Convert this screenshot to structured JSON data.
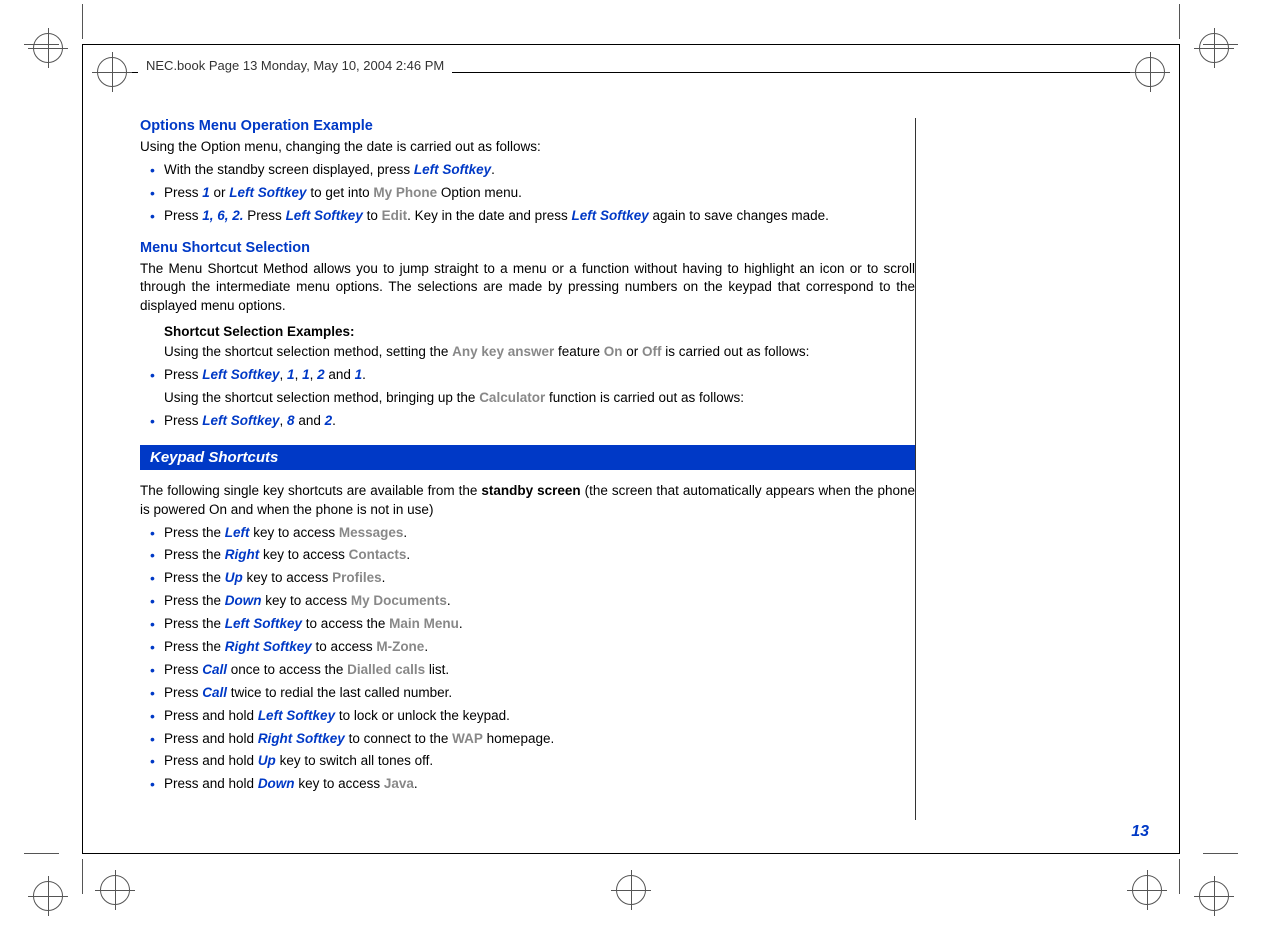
{
  "header": {
    "text": "NEC.book  Page 13  Monday, May 10, 2004  2:46 PM"
  },
  "content": {
    "section1": {
      "heading": "Options Menu Operation Example",
      "intro": "Using the Option menu, changing the date is carried out as follows:",
      "bullets": [
        {
          "pre": "With the standby screen displayed, press ",
          "key1": "Left Softkey",
          "post": "."
        },
        {
          "pre": "Press ",
          "key1": "1",
          "mid1": " or ",
          "key2": "Left Softkey",
          "mid2": " to get into ",
          "gray1": "My Phone",
          "post": " Option menu."
        },
        {
          "pre": "Press ",
          "key1": "1, 6, 2.",
          "mid1": " Press ",
          "key2": "Left Softkey",
          "mid2": " to ",
          "gray1": "Edit",
          "mid3": ". Key in the date and press ",
          "key3": "Left Softkey",
          "post": " again to save changes made."
        }
      ]
    },
    "section2": {
      "heading": "Menu Shortcut Selection",
      "intro": "The Menu Shortcut Method allows you to jump straight to a menu or a function without having to highlight an icon or to scroll through the intermediate menu options. The selections are made by pressing numbers on the keypad that correspond to the displayed menu options.",
      "subheading": "Shortcut Selection Examples:",
      "example1_pre": "Using the shortcut selection method, setting the ",
      "example1_gray1": "Any key answer",
      "example1_mid1": " feature ",
      "example1_gray2": "On",
      "example1_mid2": " or ",
      "example1_gray3": "Off",
      "example1_post": " is carried out as follows:",
      "bullet1_pre": "Press ",
      "bullet1_key1": "Left Softkey",
      "bullet1_mid1": ", ",
      "bullet1_key2": "1",
      "bullet1_mid2": ", ",
      "bullet1_key3": "1",
      "bullet1_mid3": ", ",
      "bullet1_key4": "2",
      "bullet1_mid4": " and ",
      "bullet1_key5": "1",
      "bullet1_post": ".",
      "example2_pre": "Using the shortcut selection method, bringing up the ",
      "example2_gray1": "Calculator",
      "example2_post": " function is carried out as follows:",
      "bullet2_pre": "Press ",
      "bullet2_key1": "Left Softkey",
      "bullet2_mid1": ", ",
      "bullet2_key2": "8",
      "bullet2_mid2": " and ",
      "bullet2_key3": "2",
      "bullet2_post": "."
    },
    "banner": "Keypad Shortcuts",
    "section3": {
      "intro_pre": "The following single key shortcuts are available from the ",
      "intro_bold": "standby screen",
      "intro_post": " (the screen that automatically appears when the phone is powered On and when the phone is not in use)",
      "bullets": {
        "b1": {
          "pre": "Press the ",
          "key": "Left",
          "mid": " key to access ",
          "gray": "Messages",
          "post": "."
        },
        "b2": {
          "pre": "Press the ",
          "key": "Right",
          "mid": " key to access ",
          "gray": "Contacts",
          "post": "."
        },
        "b3": {
          "pre": "Press the ",
          "key": "Up",
          "mid": " key to access ",
          "gray": "Profiles",
          "post": "."
        },
        "b4": {
          "pre": "Press the ",
          "key": "Down",
          "mid": " key to access ",
          "gray": "My Documents",
          "post": "."
        },
        "b5": {
          "pre": "Press the ",
          "key": "Left Softkey",
          "mid": " to access the ",
          "gray": "Main Menu",
          "post": "."
        },
        "b6": {
          "pre": "Press the ",
          "key": "Right Softkey",
          "mid": " to access ",
          "gray": "M-Zone",
          "post": "."
        },
        "b7": {
          "pre": "Press ",
          "key": "Call",
          "mid": " once to access the ",
          "gray": "Dialled calls",
          "post": " list."
        },
        "b8": {
          "pre": "Press ",
          "key": "Call",
          "post": " twice to redial the last called number."
        },
        "b9": {
          "pre": "Press and hold ",
          "key": "Left Softkey",
          "post": " to lock or unlock the keypad."
        },
        "b10": {
          "pre": "Press and hold ",
          "key": "Right Softkey",
          "mid": " to connect to  the ",
          "gray": "WAP",
          "post": " homepage."
        },
        "b11": {
          "pre": "Press and hold ",
          "key": "Up",
          "post": " key to switch all tones off."
        },
        "b12": {
          "pre": "Press and hold ",
          "key": "Down",
          "mid": " key to access ",
          "gray": "Java",
          "post": "."
        }
      }
    },
    "page_number": "13"
  }
}
